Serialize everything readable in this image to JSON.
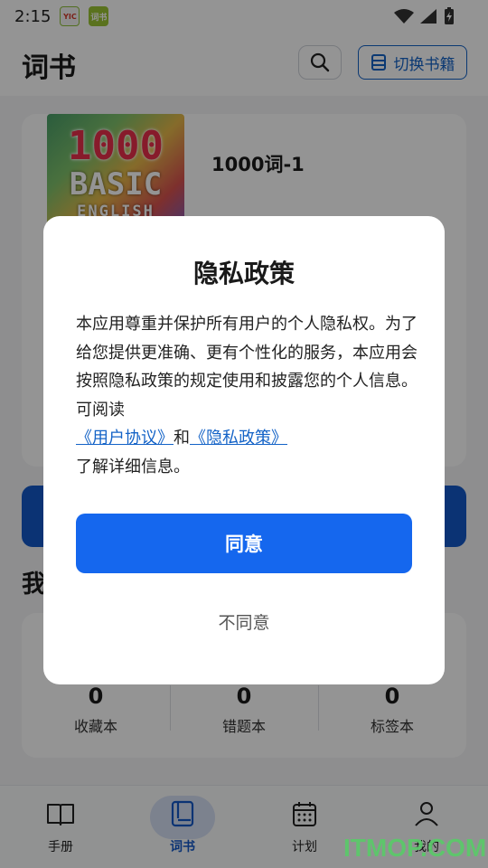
{
  "status_bar": {
    "time": "2:15",
    "app_icon_1": "YIC",
    "app_icon_2": "词书"
  },
  "header": {
    "title": "词书",
    "switch_label": "切换书籍",
    "search_icon": "search-icon",
    "book_icon": "book-stack-icon"
  },
  "book": {
    "cover_lines": [
      "1000",
      "BASIC",
      "ENGLISH"
    ],
    "name": "1000词-1"
  },
  "section": {
    "title_visible": "我"
  },
  "stats": [
    {
      "value": "0",
      "label": "收藏本"
    },
    {
      "value": "0",
      "label": "错题本"
    },
    {
      "value": "0",
      "label": "标签本"
    }
  ],
  "bottom_nav": [
    {
      "label": "手册",
      "icon": "open-book-icon",
      "active": false
    },
    {
      "label": "词书",
      "icon": "wordbook-icon",
      "active": true
    },
    {
      "label": "计划",
      "icon": "calendar-icon",
      "active": false
    },
    {
      "label": "我的",
      "icon": "person-icon",
      "active": false
    }
  ],
  "dialog": {
    "title": "隐私政策",
    "body_text": "本应用尊重并保护所有用户的个人隐私权。为了给您提供更准确、更有个性化的服务，本应用会按照隐私政策的规定使用和披露您的个人信息。可阅读",
    "link_user_agreement": "《用户协议》",
    "and_text": "和",
    "link_privacy_policy": "《隐私政策》",
    "tail_text": "了解详细信息。",
    "agree_label": "同意",
    "disagree_label": "不同意"
  },
  "watermark": "ITMOP.COM",
  "colors": {
    "primary": "#1567ee",
    "link": "#1463c7",
    "nav_active_bg": "#d6e0f5",
    "watermark": "#5cc86a"
  }
}
